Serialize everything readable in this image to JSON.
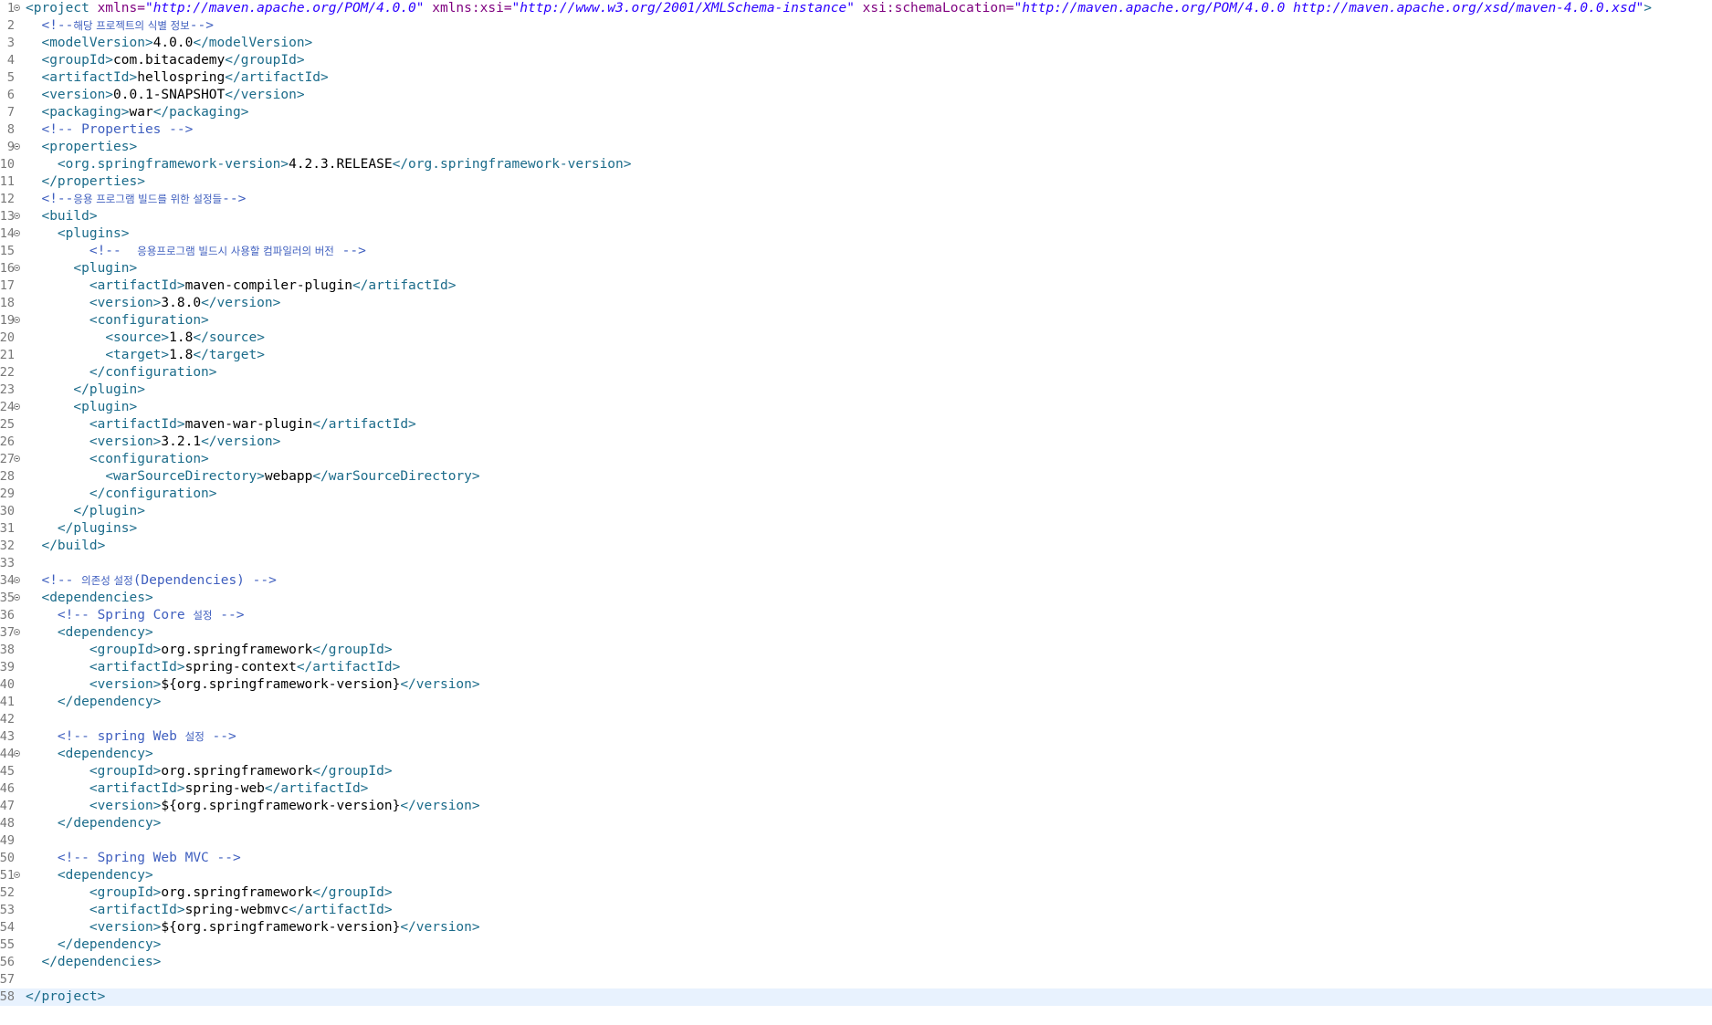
{
  "editor": {
    "current_line": 58,
    "colors": {
      "tag": "#1b6b8a",
      "attribute": "#7f007f",
      "attribute_value": "#2a00ff",
      "text": "#000000",
      "comment": "#3f5fbf",
      "line_number": "#787878",
      "current_line_highlight": "#e8f2fe"
    },
    "lines": [
      {
        "n": "1",
        "fold": true,
        "indent": "",
        "parts": [
          [
            "tag",
            "<project "
          ],
          [
            "attr",
            "xmlns="
          ],
          [
            "val",
            "\"http://maven.apache.org/POM/4.0.0\""
          ],
          [
            "attr",
            " xmlns:xsi="
          ],
          [
            "val",
            "\"http://www.w3.org/2001/XMLSchema-instance\""
          ],
          [
            "attr",
            " xsi:schemaLocation="
          ],
          [
            "val",
            "\"http://maven.apache.org/POM/4.0.0 http://maven.apache.org/xsd/maven-4.0.0.xsd\""
          ],
          [
            "tag",
            ">"
          ]
        ]
      },
      {
        "n": "2",
        "fold": false,
        "indent": "  ",
        "parts": [
          [
            "cmt",
            "<!--"
          ],
          [
            "cmt-ko",
            "해당 프로젝트의 식별 정보"
          ],
          [
            "cmt",
            "-->"
          ]
        ]
      },
      {
        "n": "3",
        "fold": false,
        "indent": "  ",
        "parts": [
          [
            "tag",
            "<modelVersion>"
          ],
          [
            "txt",
            "4.0.0"
          ],
          [
            "tag",
            "</modelVersion>"
          ]
        ]
      },
      {
        "n": "4",
        "fold": false,
        "indent": "  ",
        "parts": [
          [
            "tag",
            "<groupId>"
          ],
          [
            "txt",
            "com.bitacademy"
          ],
          [
            "tag",
            "</groupId>"
          ]
        ]
      },
      {
        "n": "5",
        "fold": false,
        "indent": "  ",
        "parts": [
          [
            "tag",
            "<artifactId>"
          ],
          [
            "txt",
            "hellospring"
          ],
          [
            "tag",
            "</artifactId>"
          ]
        ]
      },
      {
        "n": "6",
        "fold": false,
        "indent": "  ",
        "parts": [
          [
            "tag",
            "<version>"
          ],
          [
            "txt",
            "0.0.1-SNAPSHOT"
          ],
          [
            "tag",
            "</version>"
          ]
        ]
      },
      {
        "n": "7",
        "fold": false,
        "indent": "  ",
        "parts": [
          [
            "tag",
            "<packaging>"
          ],
          [
            "txt",
            "war"
          ],
          [
            "tag",
            "</packaging>"
          ]
        ]
      },
      {
        "n": "8",
        "fold": false,
        "indent": "  ",
        "parts": [
          [
            "cmt",
            "<!-- Properties -->"
          ]
        ]
      },
      {
        "n": "9",
        "fold": true,
        "indent": "  ",
        "parts": [
          [
            "tag",
            "<properties>"
          ]
        ]
      },
      {
        "n": "10",
        "fold": false,
        "indent": "    ",
        "parts": [
          [
            "tag",
            "<org.springframework-version>"
          ],
          [
            "txt",
            "4.2.3.RELEASE"
          ],
          [
            "tag",
            "</org.springframework-version>"
          ]
        ]
      },
      {
        "n": "11",
        "fold": false,
        "indent": "  ",
        "parts": [
          [
            "tag",
            "</properties>"
          ]
        ]
      },
      {
        "n": "12",
        "fold": false,
        "indent": "  ",
        "parts": [
          [
            "cmt",
            "<!--"
          ],
          [
            "cmt-ko",
            "응용 프로그램 빌드를 위한 설정들"
          ],
          [
            "cmt",
            "-->"
          ]
        ]
      },
      {
        "n": "13",
        "fold": true,
        "indent": "  ",
        "parts": [
          [
            "tag",
            "<build>"
          ]
        ]
      },
      {
        "n": "14",
        "fold": true,
        "indent": "    ",
        "parts": [
          [
            "tag",
            "<plugins>"
          ]
        ]
      },
      {
        "n": "15",
        "fold": false,
        "indent": "        ",
        "parts": [
          [
            "cmt",
            "<!--  "
          ],
          [
            "cmt-ko",
            "응용프로그램 빌드시 사용할 컴파일러의 버전"
          ],
          [
            "cmt",
            " -->"
          ]
        ]
      },
      {
        "n": "16",
        "fold": true,
        "indent": "      ",
        "parts": [
          [
            "tag",
            "<plugin>"
          ]
        ]
      },
      {
        "n": "17",
        "fold": false,
        "indent": "        ",
        "parts": [
          [
            "tag",
            "<artifactId>"
          ],
          [
            "txt",
            "maven-compiler-plugin"
          ],
          [
            "tag",
            "</artifactId>"
          ]
        ]
      },
      {
        "n": "18",
        "fold": false,
        "indent": "        ",
        "parts": [
          [
            "tag",
            "<version>"
          ],
          [
            "txt",
            "3.8.0"
          ],
          [
            "tag",
            "</version>"
          ]
        ]
      },
      {
        "n": "19",
        "fold": true,
        "indent": "        ",
        "parts": [
          [
            "tag",
            "<configuration>"
          ]
        ]
      },
      {
        "n": "20",
        "fold": false,
        "indent": "          ",
        "parts": [
          [
            "tag",
            "<source>"
          ],
          [
            "txt",
            "1.8"
          ],
          [
            "tag",
            "</source>"
          ]
        ]
      },
      {
        "n": "21",
        "fold": false,
        "indent": "          ",
        "parts": [
          [
            "tag",
            "<target>"
          ],
          [
            "txt",
            "1.8"
          ],
          [
            "tag",
            "</target>"
          ]
        ]
      },
      {
        "n": "22",
        "fold": false,
        "indent": "        ",
        "parts": [
          [
            "tag",
            "</configuration>"
          ]
        ]
      },
      {
        "n": "23",
        "fold": false,
        "indent": "      ",
        "parts": [
          [
            "tag",
            "</plugin>"
          ]
        ]
      },
      {
        "n": "24",
        "fold": true,
        "indent": "      ",
        "parts": [
          [
            "tag",
            "<plugin>"
          ]
        ]
      },
      {
        "n": "25",
        "fold": false,
        "indent": "        ",
        "parts": [
          [
            "tag",
            "<artifactId>"
          ],
          [
            "txt",
            "maven-war-plugin"
          ],
          [
            "tag",
            "</artifactId>"
          ]
        ]
      },
      {
        "n": "26",
        "fold": false,
        "indent": "        ",
        "parts": [
          [
            "tag",
            "<version>"
          ],
          [
            "txt",
            "3.2.1"
          ],
          [
            "tag",
            "</version>"
          ]
        ]
      },
      {
        "n": "27",
        "fold": true,
        "indent": "        ",
        "parts": [
          [
            "tag",
            "<configuration>"
          ]
        ]
      },
      {
        "n": "28",
        "fold": false,
        "indent": "          ",
        "parts": [
          [
            "tag",
            "<warSourceDirectory>"
          ],
          [
            "txt",
            "webapp"
          ],
          [
            "tag",
            "</warSourceDirectory>"
          ]
        ]
      },
      {
        "n": "29",
        "fold": false,
        "indent": "        ",
        "parts": [
          [
            "tag",
            "</configuration>"
          ]
        ]
      },
      {
        "n": "30",
        "fold": false,
        "indent": "      ",
        "parts": [
          [
            "tag",
            "</plugin>"
          ]
        ]
      },
      {
        "n": "31",
        "fold": false,
        "indent": "    ",
        "parts": [
          [
            "tag",
            "</plugins>"
          ]
        ]
      },
      {
        "n": "32",
        "fold": false,
        "indent": "  ",
        "parts": [
          [
            "tag",
            "</build>"
          ]
        ]
      },
      {
        "n": "33",
        "fold": false,
        "indent": "",
        "parts": []
      },
      {
        "n": "34",
        "fold": true,
        "indent": "  ",
        "parts": [
          [
            "cmt",
            "<!-- "
          ],
          [
            "cmt-ko",
            "의존성 설정"
          ],
          [
            "cmt",
            "(Dependencies) -->"
          ]
        ]
      },
      {
        "n": "35",
        "fold": true,
        "indent": "  ",
        "parts": [
          [
            "tag",
            "<dependencies>"
          ]
        ]
      },
      {
        "n": "36",
        "fold": false,
        "indent": "    ",
        "parts": [
          [
            "cmt",
            "<!-- Spring Core "
          ],
          [
            "cmt-ko",
            "설정"
          ],
          [
            "cmt",
            " -->"
          ]
        ]
      },
      {
        "n": "37",
        "fold": true,
        "indent": "    ",
        "parts": [
          [
            "tag",
            "<dependency>"
          ]
        ]
      },
      {
        "n": "38",
        "fold": false,
        "indent": "        ",
        "parts": [
          [
            "tag",
            "<groupId>"
          ],
          [
            "txt",
            "org.springframework"
          ],
          [
            "tag",
            "</groupId>"
          ]
        ]
      },
      {
        "n": "39",
        "fold": false,
        "indent": "        ",
        "parts": [
          [
            "tag",
            "<artifactId>"
          ],
          [
            "txt",
            "spring-context"
          ],
          [
            "tag",
            "</artifactId>"
          ]
        ]
      },
      {
        "n": "40",
        "fold": false,
        "indent": "        ",
        "parts": [
          [
            "tag",
            "<version>"
          ],
          [
            "txt",
            "${org.springframework-version}"
          ],
          [
            "tag",
            "</version>"
          ]
        ]
      },
      {
        "n": "41",
        "fold": false,
        "indent": "    ",
        "parts": [
          [
            "tag",
            "</dependency>"
          ]
        ]
      },
      {
        "n": "42",
        "fold": false,
        "indent": "",
        "parts": []
      },
      {
        "n": "43",
        "fold": false,
        "indent": "    ",
        "parts": [
          [
            "cmt",
            "<!-- spring Web "
          ],
          [
            "cmt-ko",
            "설정"
          ],
          [
            "cmt",
            " -->"
          ]
        ]
      },
      {
        "n": "44",
        "fold": true,
        "indent": "    ",
        "parts": [
          [
            "tag",
            "<dependency>"
          ]
        ]
      },
      {
        "n": "45",
        "fold": false,
        "indent": "        ",
        "parts": [
          [
            "tag",
            "<groupId>"
          ],
          [
            "txt",
            "org.springframework"
          ],
          [
            "tag",
            "</groupId>"
          ]
        ]
      },
      {
        "n": "46",
        "fold": false,
        "indent": "        ",
        "parts": [
          [
            "tag",
            "<artifactId>"
          ],
          [
            "txt",
            "spring-web"
          ],
          [
            "tag",
            "</artifactId>"
          ]
        ]
      },
      {
        "n": "47",
        "fold": false,
        "indent": "        ",
        "parts": [
          [
            "tag",
            "<version>"
          ],
          [
            "txt",
            "${org.springframework-version}"
          ],
          [
            "tag",
            "</version>"
          ]
        ]
      },
      {
        "n": "48",
        "fold": false,
        "indent": "    ",
        "parts": [
          [
            "tag",
            "</dependency>"
          ]
        ]
      },
      {
        "n": "49",
        "fold": false,
        "indent": "",
        "parts": []
      },
      {
        "n": "50",
        "fold": false,
        "indent": "    ",
        "parts": [
          [
            "cmt",
            "<!-- Spring Web MVC -->"
          ]
        ]
      },
      {
        "n": "51",
        "fold": true,
        "indent": "    ",
        "parts": [
          [
            "tag",
            "<dependency>"
          ]
        ]
      },
      {
        "n": "52",
        "fold": false,
        "indent": "        ",
        "parts": [
          [
            "tag",
            "<groupId>"
          ],
          [
            "txt",
            "org.springframework"
          ],
          [
            "tag",
            "</groupId>"
          ]
        ]
      },
      {
        "n": "53",
        "fold": false,
        "indent": "        ",
        "parts": [
          [
            "tag",
            "<artifactId>"
          ],
          [
            "txt",
            "spring-webmvc"
          ],
          [
            "tag",
            "</artifactId>"
          ]
        ]
      },
      {
        "n": "54",
        "fold": false,
        "indent": "        ",
        "parts": [
          [
            "tag",
            "<version>"
          ],
          [
            "txt",
            "${org.springframework-version}"
          ],
          [
            "tag",
            "</version>"
          ]
        ]
      },
      {
        "n": "55",
        "fold": false,
        "indent": "    ",
        "parts": [
          [
            "tag",
            "</dependency>"
          ]
        ]
      },
      {
        "n": "56",
        "fold": false,
        "indent": "  ",
        "parts": [
          [
            "tag",
            "</dependencies>"
          ]
        ]
      },
      {
        "n": "57",
        "fold": false,
        "indent": "",
        "parts": []
      },
      {
        "n": "58",
        "fold": false,
        "indent": "",
        "parts": [
          [
            "tag",
            "</project>"
          ]
        ]
      }
    ]
  }
}
